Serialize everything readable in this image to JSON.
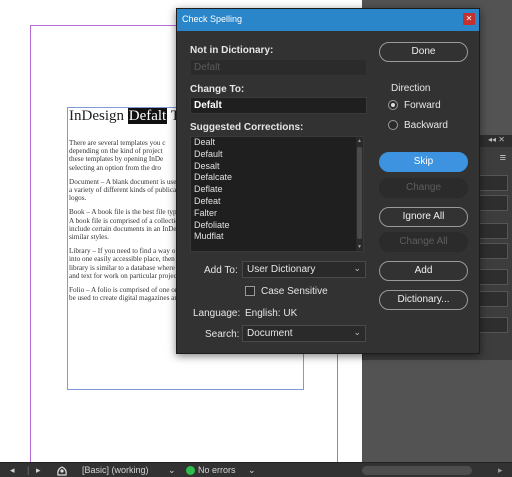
{
  "document": {
    "title_prefix": "InDesign ",
    "title_highlight": "Defalt",
    "title_suffix": " Te",
    "paragraphs": [
      "There are several templates you c",
      "depending on the kind of project",
      "these templates by opening InDe",
      "selecting an option from the dro",
      "Document – A blank document is use",
      "a variety of different kinds of publicati",
      "logos.",
      "Book – A book file is the best file type",
      "A book file is comprised of a collectio",
      "include certain documents in an InDe",
      "similar styles.",
      "Library – If you need to find a way of",
      "into one easily accessible place, then y",
      "library is similar to a database where",
      "and text for work on particular projec",
      "Folio – A folio is comprised of one or",
      "be used to create digital magazines an"
    ]
  },
  "dialog": {
    "title": "Check Spelling",
    "not_in_dictionary_label": "Not in Dictionary:",
    "not_in_dictionary_value": "Defalt",
    "change_to_label": "Change To:",
    "change_to_value": "Defalt",
    "suggested_corrections_label": "Suggested Corrections:",
    "suggestions": [
      "Dealt",
      "Default",
      "Desalt",
      "Defalcate",
      "Deflate",
      "Defeat",
      "Falter",
      "Defoliate",
      "Mudflat"
    ],
    "add_to_label": "Add To:",
    "add_to_value": "User Dictionary",
    "case_sensitive_label": "Case Sensitive",
    "language_label": "Language:",
    "language_value": "English: UK",
    "search_label": "Search:",
    "search_value": "Document",
    "direction_label": "Direction",
    "forward_label": "Forward",
    "backward_label": "Backward",
    "buttons": {
      "done": "Done",
      "skip": "Skip",
      "change": "Change",
      "ignore_all": "Ignore All",
      "change_all": "Change All",
      "add": "Add",
      "dictionary": "Dictionary..."
    }
  },
  "statusbar": {
    "style": "[Basic] (working)",
    "errors": "No errors"
  },
  "colors": {
    "titlebar": "#2a86c9",
    "primary_button": "#3d93e0",
    "close_button": "#c4302b",
    "status_ok": "#2ebd4a"
  }
}
